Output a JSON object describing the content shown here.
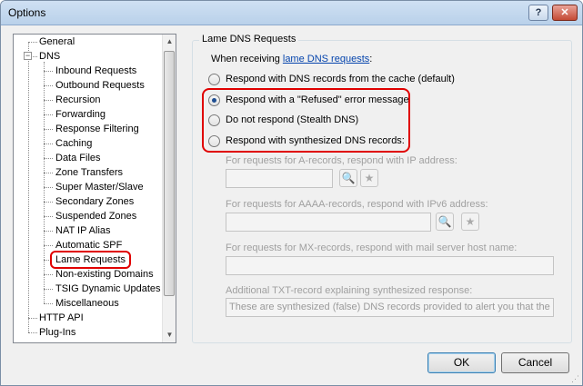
{
  "window": {
    "title": "Options",
    "help_glyph": "?",
    "close_glyph": "✕"
  },
  "tree": {
    "general": "General",
    "dns": "DNS",
    "dns_children": [
      "Inbound Requests",
      "Outbound Requests",
      "Recursion",
      "Forwarding",
      "Response Filtering",
      "Caching",
      "Data Files",
      "Zone Transfers",
      "Super Master/Slave",
      "Secondary Zones",
      "Suspended Zones",
      "NAT IP Alias",
      "Automatic SPF",
      "Lame Requests",
      "Non-existing Domains",
      "TSIG Dynamic Updates",
      "Miscellaneous"
    ],
    "selected": "Lame Requests",
    "http_api": "HTTP API",
    "plugins": "Plug-Ins"
  },
  "panel": {
    "group_title": "Lame DNS Requests",
    "intro_prefix": "When receiving ",
    "intro_link": "lame DNS requests",
    "intro_suffix": ":",
    "options": [
      "Respond with DNS records from the cache (default)",
      "Respond with a \"Refused\" error message",
      "Do not respond (Stealth DNS)",
      "Respond with synthesized DNS records:"
    ],
    "selected_option": 1,
    "a_label": "For requests for A-records, respond with IP address:",
    "aaaa_label": "For requests for AAAA-records, respond with IPv6 address:",
    "mx_label": "For requests for MX-records, respond with mail server host name:",
    "txt_label": "Additional TXT-record explaining synthesized response:",
    "txt_value": "These are synthesized (false) DNS records provided to alert you that the rec"
  },
  "buttons": {
    "ok": "OK",
    "cancel": "Cancel"
  }
}
